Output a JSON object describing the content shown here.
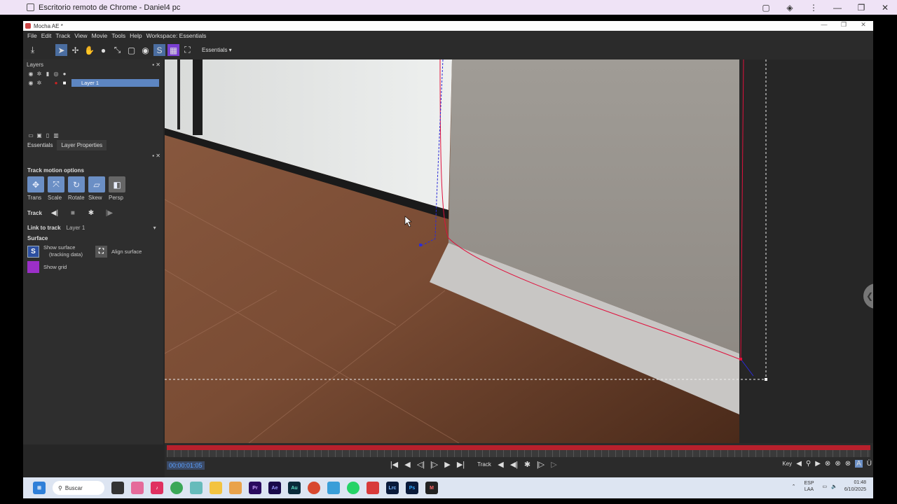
{
  "remote_bar": {
    "title": "Escritorio remoto de Chrome - Daniel4 pc",
    "controls": [
      "▢",
      "◈",
      "⋮",
      "—",
      "❐",
      "✕"
    ]
  },
  "app": {
    "title": "Mocha AE *",
    "window_controls": [
      "—",
      "❐",
      "✕"
    ],
    "menu": [
      "File",
      "Edit",
      "Track",
      "View",
      "Movie",
      "Tools",
      "Help",
      "Workspace: Essentials"
    ],
    "workspace_select": "Essentials ▾"
  },
  "layers_panel": {
    "header": "Layers",
    "layer_name": "Layer 1",
    "tabs": [
      "Essentials",
      "Layer Properties"
    ]
  },
  "track_motion": {
    "title": "Track motion options",
    "labels": [
      "Trans",
      "Scale",
      "Rotate",
      "Skew",
      "Persp"
    ],
    "track_label": "Track"
  },
  "link_to_track": {
    "label": "Link to track",
    "value": "Layer 1"
  },
  "surface": {
    "title": "Surface",
    "show_surface_1": "Show surface",
    "show_surface_2": "(tracking data)",
    "align_surface": "Align surface",
    "show_grid": "Show grid"
  },
  "timeline": {
    "timecode": "00:00:01:05",
    "track_label": "Track",
    "key_label": "Key"
  },
  "taskbar": {
    "search": "Buscar",
    "lang_1": "ESP",
    "lang_2": "LAA",
    "time": "01:48",
    "date": "6/10/2025"
  },
  "colors": {
    "accent": "#5d86c2",
    "timeline_red": "#b8202c",
    "spline_red": "#e0103c",
    "spline_blue": "#2c2cd8"
  }
}
